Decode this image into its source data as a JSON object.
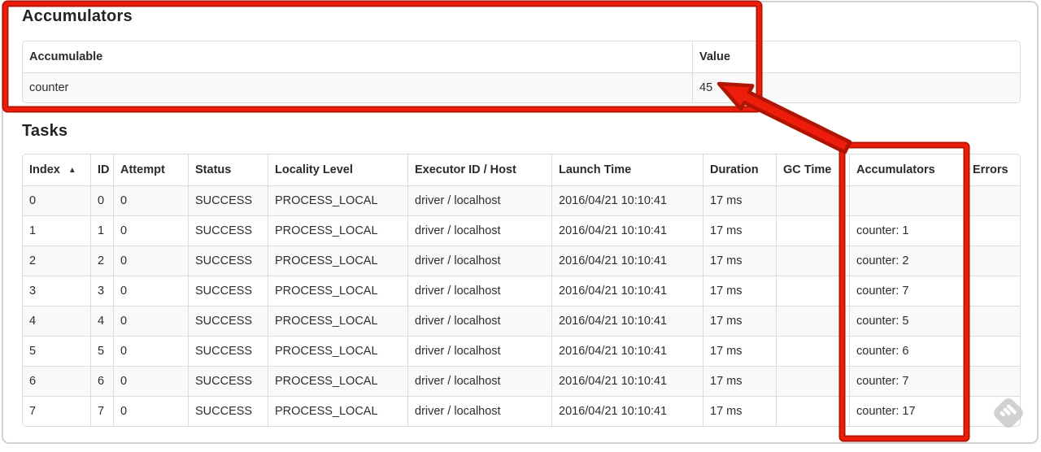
{
  "annotations": {
    "color": "#ee1d0b",
    "outline_color": "#b01403"
  },
  "accumulators_section": {
    "title": "Accumulators",
    "table": {
      "headers": [
        "Accumulable",
        "Value"
      ],
      "rows": [
        [
          "counter",
          "45"
        ]
      ]
    }
  },
  "tasks_section": {
    "title": "Tasks",
    "table": {
      "headers": [
        "Index",
        "ID",
        "Attempt",
        "Status",
        "Locality Level",
        "Executor ID / Host",
        "Launch Time",
        "Duration",
        "GC Time",
        "Accumulators",
        "Errors"
      ],
      "sort_column": "Index",
      "sort_indicator": "▲",
      "rows": [
        [
          "0",
          "0",
          "0",
          "SUCCESS",
          "PROCESS_LOCAL",
          "driver / localhost",
          "2016/04/21 10:10:41",
          "17 ms",
          "",
          "",
          ""
        ],
        [
          "1",
          "1",
          "0",
          "SUCCESS",
          "PROCESS_LOCAL",
          "driver / localhost",
          "2016/04/21 10:10:41",
          "17 ms",
          "",
          "counter: 1",
          ""
        ],
        [
          "2",
          "2",
          "0",
          "SUCCESS",
          "PROCESS_LOCAL",
          "driver / localhost",
          "2016/04/21 10:10:41",
          "17 ms",
          "",
          "counter: 2",
          ""
        ],
        [
          "3",
          "3",
          "0",
          "SUCCESS",
          "PROCESS_LOCAL",
          "driver / localhost",
          "2016/04/21 10:10:41",
          "17 ms",
          "",
          "counter: 7",
          ""
        ],
        [
          "4",
          "4",
          "0",
          "SUCCESS",
          "PROCESS_LOCAL",
          "driver / localhost",
          "2016/04/21 10:10:41",
          "17 ms",
          "",
          "counter: 5",
          ""
        ],
        [
          "5",
          "5",
          "0",
          "SUCCESS",
          "PROCESS_LOCAL",
          "driver / localhost",
          "2016/04/21 10:10:41",
          "17 ms",
          "",
          "counter: 6",
          ""
        ],
        [
          "6",
          "6",
          "0",
          "SUCCESS",
          "PROCESS_LOCAL",
          "driver / localhost",
          "2016/04/21 10:10:41",
          "17 ms",
          "",
          "counter: 7",
          ""
        ],
        [
          "7",
          "7",
          "0",
          "SUCCESS",
          "PROCESS_LOCAL",
          "driver / localhost",
          "2016/04/21 10:10:41",
          "17 ms",
          "",
          "counter: 17",
          ""
        ]
      ]
    }
  },
  "watermark": {
    "icon": "feedly-logo"
  }
}
